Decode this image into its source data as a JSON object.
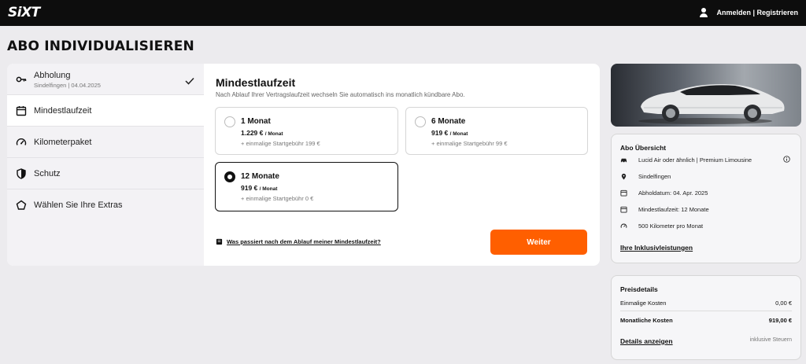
{
  "header": {
    "logo": "SiXT",
    "account_link": "Anmelden | Registrieren"
  },
  "page_title": "ABO INDIVIDUALISIEREN",
  "steps": [
    {
      "label": "Abholung",
      "sub": "Sindelfingen | 04.04.2025",
      "icon": "key-icon",
      "done": true
    },
    {
      "label": "Mindestlaufzeit",
      "icon": "calendar-icon",
      "active": true
    },
    {
      "label": "Kilometerpaket",
      "icon": "speedometer-icon"
    },
    {
      "label": "Schutz",
      "icon": "shield-icon"
    },
    {
      "label": "Wählen Sie Ihre Extras",
      "icon": "pentagon-icon"
    }
  ],
  "content": {
    "title": "Mindestlaufzeit",
    "subtitle": "Nach Ablauf Ihrer Vertragslaufzeit wechseln Sie automatisch ins monatlich kündbare Abo.",
    "options": [
      {
        "title": "1 Monat",
        "price": "1.229 €",
        "unit": "/ Monat",
        "fee": "+ einmalige Startgebühr 199 €",
        "selected": false
      },
      {
        "title": "6 Monate",
        "price": "919 €",
        "unit": "/ Monat",
        "fee": "+ einmalige Startgebühr 99 €",
        "selected": false
      },
      {
        "title": "12 Monate",
        "price": "919 €",
        "unit": "/ Monat",
        "fee": "+ einmalige Startgebühr 0 €",
        "selected": true
      }
    ],
    "faq_link": "Was passiert nach dem Ablauf meiner Mindestlaufzeit?",
    "continue_button": "Weiter"
  },
  "summary": {
    "title": "Abo Übersicht",
    "rows": [
      {
        "icon": "car-icon",
        "text": "Lucid Air oder ähnlich | Premium Limousine"
      },
      {
        "icon": "location-pin-icon",
        "text": "Sindelfingen"
      },
      {
        "icon": "calendar-icon",
        "text": "Abholdatum: 04. Apr. 2025"
      },
      {
        "icon": "calendar-icon",
        "text": "Mindestlaufzeit: 12 Monate"
      },
      {
        "icon": "speedometer-icon",
        "text": "500 Kilometer pro Monat"
      }
    ],
    "inclusions_link": "Ihre Inklusivleistungen"
  },
  "price": {
    "title": "Preisdetails",
    "one_time_label": "Einmalige Kosten",
    "one_time_value": "0,00 €",
    "monthly_label": "Monatliche Kosten",
    "monthly_value": "919,00 €",
    "details_link": "Details anzeigen",
    "tax_note": "inklusive Steuern"
  },
  "colors": {
    "accent": "#ff5f00",
    "header_bg": "#0d0d0d",
    "page_bg": "#ecebee"
  }
}
